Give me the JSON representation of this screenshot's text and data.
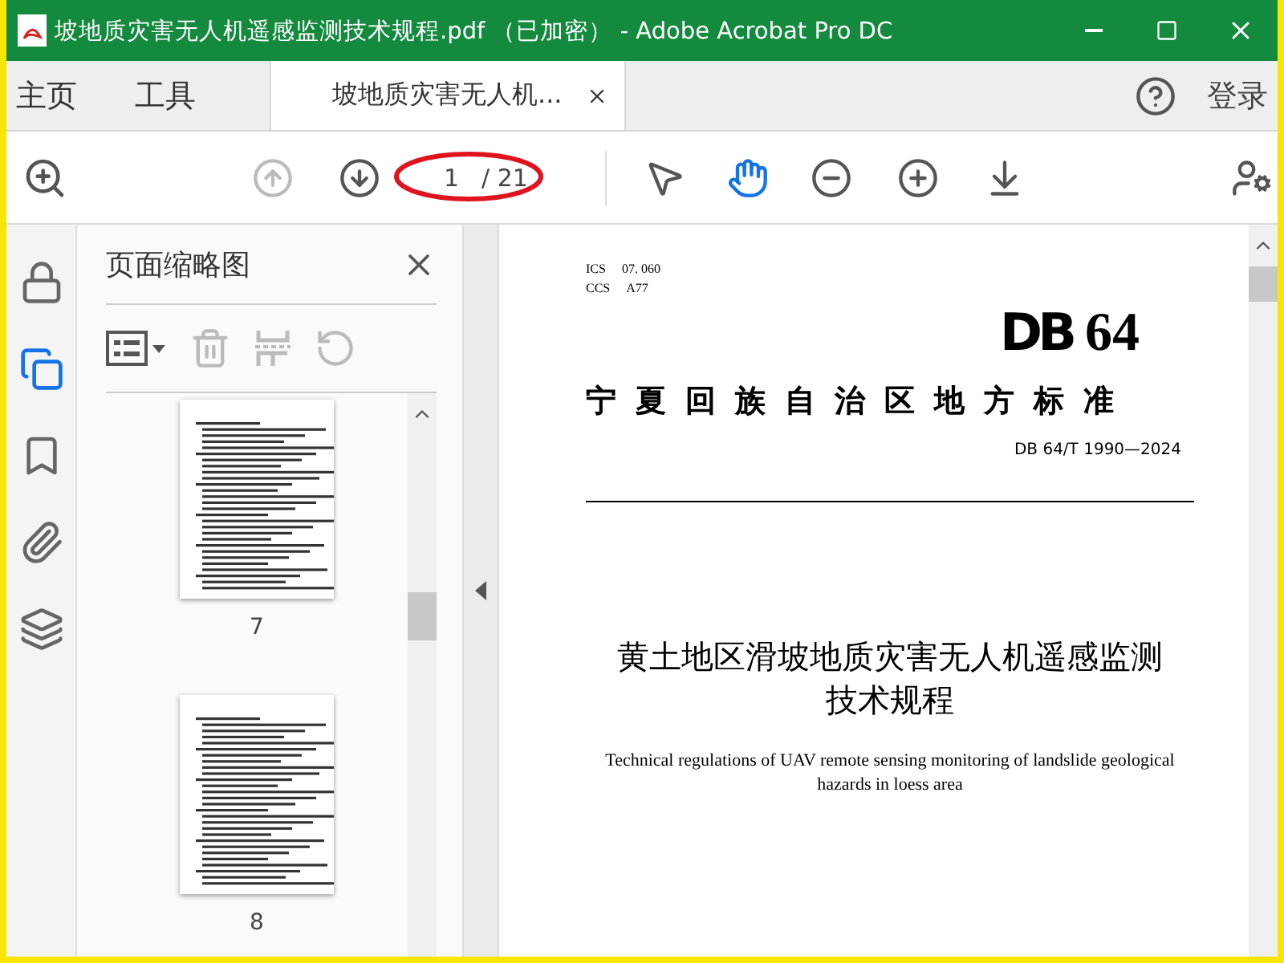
{
  "window": {
    "title": "坡地质灾害无人机遥感监测技术规程.pdf （已加密） - Adobe Acrobat Pro DC"
  },
  "tabs": [
    {
      "label": "主页",
      "kind": "nav",
      "selected": false
    },
    {
      "label": "工具",
      "kind": "nav",
      "selected": false
    },
    {
      "label": "坡地质灾害无人机...",
      "kind": "document",
      "selected": true
    }
  ],
  "account": {
    "label": "登录"
  },
  "toolbar": {
    "prev_disabled": true,
    "next_disabled": false,
    "page_current": "1",
    "page_total": "/ 21",
    "tools": [
      {
        "kind": "select",
        "selected": false
      },
      {
        "kind": "hand",
        "selected": true
      }
    ]
  },
  "rail": [
    {
      "kind": "lock",
      "selected": false
    },
    {
      "kind": "pages",
      "selected": true
    },
    {
      "kind": "bookmark",
      "selected": false
    },
    {
      "kind": "attachment",
      "selected": false
    },
    {
      "kind": "layers",
      "selected": false
    }
  ],
  "panel": {
    "title": "页面缩略图",
    "thumbnails": [
      {
        "page": "7"
      },
      {
        "page": "8"
      }
    ]
  },
  "document": {
    "ics_label": "ICS",
    "ics": "07. 060",
    "ccs_label": "CCS",
    "ccs": "A77",
    "code": "DB",
    "code_number": "64",
    "authority": "宁夏回族自治区地方标准",
    "standard_no": "DB 64/T 1990—2024",
    "title_lines": [
      "黄土地区滑坡地质灾害无人机遥感监测",
      "技术规程"
    ],
    "title_en": "Technical regulations of UAV remote sensing monitoring of landslide geological hazards in loess area"
  }
}
